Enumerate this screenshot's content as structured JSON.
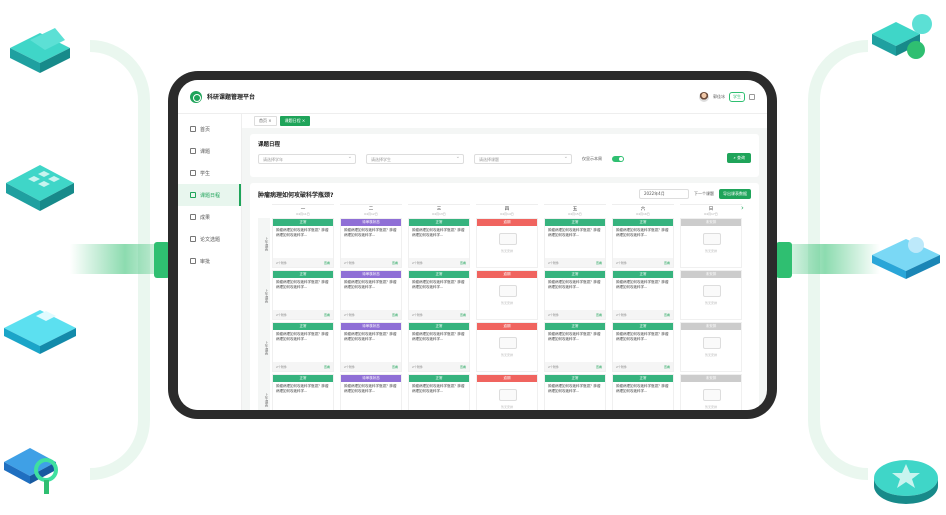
{
  "app": {
    "title": "科研课题管理平台",
    "user_name": "郭佳冰",
    "role": "学生"
  },
  "sidebar": {
    "items": [
      {
        "label": "首页",
        "icon": "home-icon"
      },
      {
        "label": "课题",
        "icon": "topic-icon"
      },
      {
        "label": "学生",
        "icon": "student-icon"
      },
      {
        "label": "课题日程",
        "icon": "calendar-icon",
        "active": true
      },
      {
        "label": "成果",
        "icon": "achievement-icon"
      },
      {
        "label": "论文选题",
        "icon": "paper-icon"
      },
      {
        "label": "审批",
        "icon": "approve-icon"
      }
    ]
  },
  "tabs": [
    {
      "label": "首页"
    },
    {
      "label": "课题日程",
      "active": true
    }
  ],
  "filters": {
    "title": "课题日程",
    "select1": "请选择学年",
    "select2": "请选择学生",
    "select3": "请选择课题",
    "toggle_label": "仅显示本周",
    "toggle_on": true,
    "search_label": "查询"
  },
  "schedule": {
    "title": "肿瘤病理如何攻破科学瓶颈?",
    "month": "2022年4月",
    "next_week": "下一个课题",
    "export": "导出课表数据",
    "days": [
      {
        "name": "一",
        "date": "04月11日"
      },
      {
        "name": "二",
        "date": "04月12日"
      },
      {
        "name": "三",
        "date": "04月13日"
      },
      {
        "name": "四",
        "date": "04月14日"
      },
      {
        "name": "五",
        "date": "04月15日"
      },
      {
        "name": "六",
        "date": "04月16日"
      },
      {
        "name": "日",
        "date": "04月17日"
      }
    ],
    "row_label": "上午课表",
    "cell_text": "肿瘤病理如何攻破科学瓶颈？肿瘤病理如何攻破科学...",
    "footer_count": "2个附件",
    "footer_action": "查看",
    "empty_text": "暂无安排",
    "status_labels": {
      "done": "正常",
      "pending": "待审核状态",
      "late": "逾期",
      "none": "未安排"
    },
    "colors": {
      "done": "#36b37e",
      "pending": "#8f6fd6",
      "late": "#f0645f",
      "none": "#cccccc"
    },
    "rows": [
      [
        "done",
        "pending",
        "done",
        "late",
        "done",
        "done",
        "none"
      ],
      [
        "done",
        "pending",
        "done",
        "late",
        "done",
        "done",
        "none"
      ],
      [
        "done",
        "pending",
        "done",
        "late",
        "done",
        "done",
        "none"
      ],
      [
        "done",
        "pending",
        "done",
        "late",
        "done",
        "done",
        "none"
      ]
    ]
  }
}
